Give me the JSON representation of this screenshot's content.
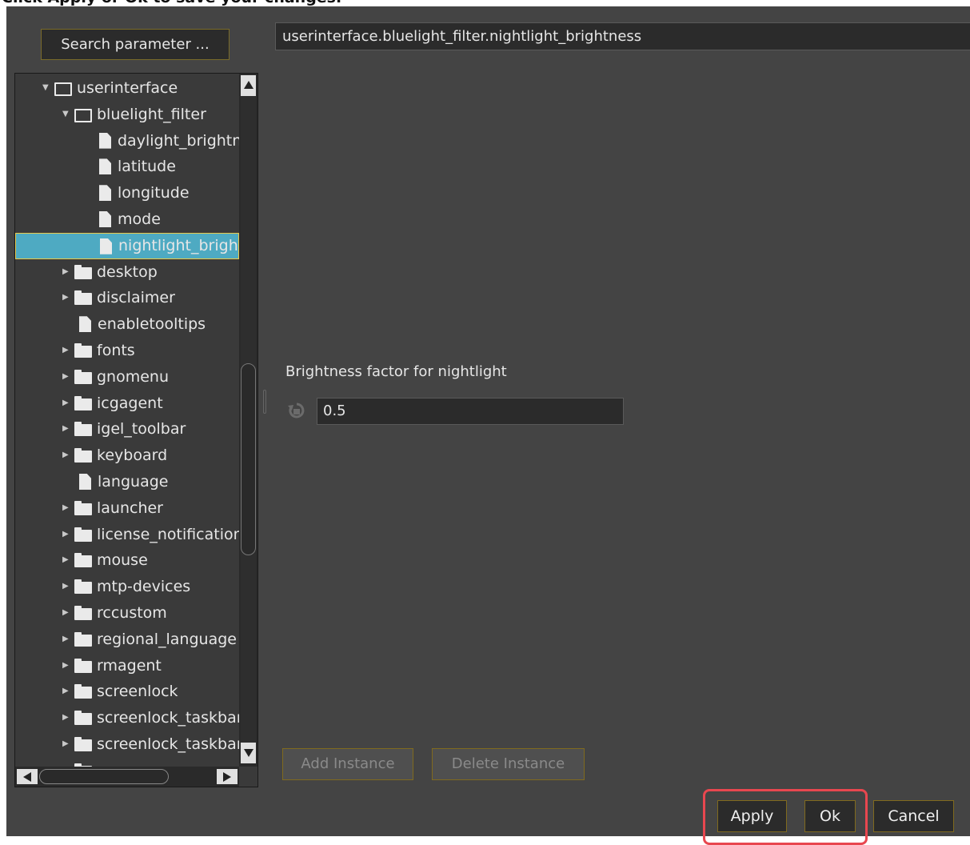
{
  "instruction_banner": {
    "text": "Click Apply or Ok to save your changes."
  },
  "search": {
    "label": "Search parameter ..."
  },
  "path_field": {
    "value": "userinterface.bluelight_filter.nightlight_brightness"
  },
  "tree": {
    "rows": [
      {
        "label": "userinterface",
        "kind": "folder-open",
        "depth": 0,
        "expanded": true
      },
      {
        "label": "bluelight_filter",
        "kind": "folder-open",
        "depth": 1,
        "expanded": true
      },
      {
        "label": "daylight_brightness",
        "kind": "file",
        "depth": 2
      },
      {
        "label": "latitude",
        "kind": "file",
        "depth": 2
      },
      {
        "label": "longitude",
        "kind": "file",
        "depth": 2
      },
      {
        "label": "mode",
        "kind": "file",
        "depth": 2
      },
      {
        "label": "nightlight_brightness",
        "kind": "file",
        "depth": 2,
        "selected": true
      },
      {
        "label": "desktop",
        "kind": "folder",
        "depth": 1
      },
      {
        "label": "disclaimer",
        "kind": "folder",
        "depth": 1
      },
      {
        "label": "enabletooltips",
        "kind": "file",
        "depth": 1
      },
      {
        "label": "fonts",
        "kind": "folder",
        "depth": 1
      },
      {
        "label": "gnomenu",
        "kind": "folder",
        "depth": 1
      },
      {
        "label": "icgagent",
        "kind": "folder",
        "depth": 1
      },
      {
        "label": "igel_toolbar",
        "kind": "folder",
        "depth": 1
      },
      {
        "label": "keyboard",
        "kind": "folder",
        "depth": 1
      },
      {
        "label": "language",
        "kind": "file",
        "depth": 1
      },
      {
        "label": "launcher",
        "kind": "folder",
        "depth": 1
      },
      {
        "label": "license_notification",
        "kind": "folder",
        "depth": 1
      },
      {
        "label": "mouse",
        "kind": "folder",
        "depth": 1
      },
      {
        "label": "mtp-devices",
        "kind": "folder",
        "depth": 1
      },
      {
        "label": "rccustom",
        "kind": "folder",
        "depth": 1
      },
      {
        "label": "regional_language",
        "kind": "folder",
        "depth": 1
      },
      {
        "label": "rmagent",
        "kind": "folder",
        "depth": 1
      },
      {
        "label": "screenlock",
        "kind": "folder",
        "depth": 1
      },
      {
        "label": "screenlock_taskbar",
        "kind": "folder",
        "depth": 1
      },
      {
        "label": "screenlock_taskbar",
        "kind": "folder",
        "depth": 1
      },
      {
        "label": "",
        "kind": "folder",
        "depth": 1
      }
    ]
  },
  "parameter": {
    "description": "Brightness factor for nightlight",
    "value": "0.5",
    "reset_icon": "reset-to-default-icon"
  },
  "instance_buttons": {
    "add": "Add Instance",
    "delete": "Delete Instance"
  },
  "dialog_buttons": {
    "apply": "Apply",
    "ok": "Ok",
    "cancel": "Cancel"
  },
  "colors": {
    "background": "#444444",
    "field_bg": "#2b2b2b",
    "selection": "#4eaac2",
    "button_border": "#806a1e",
    "highlight": "#e8474f"
  }
}
